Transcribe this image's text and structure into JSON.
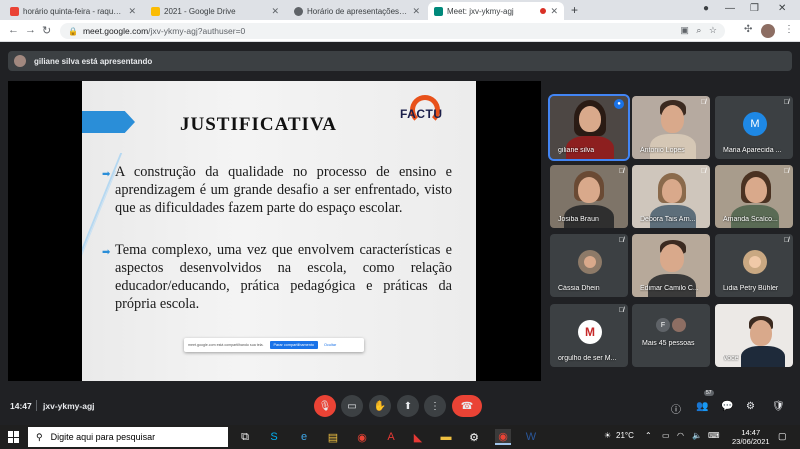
{
  "browser": {
    "tabs": [
      {
        "title": "horário quinta-feira - raquel.veto",
        "favicon": "gmail-icon",
        "color": "#ea4335"
      },
      {
        "title": "2021 - Google Drive",
        "favicon": "drive-icon",
        "color": "#fbbc04"
      },
      {
        "title": "Horário de apresentações de tra",
        "favicon": "globe-icon",
        "color": "#5f6368"
      },
      {
        "title": "Meet: jxv-ykmy-agj",
        "favicon": "meet-icon",
        "color": "#00897b"
      }
    ],
    "new_tab": "+",
    "url_host": "meet.google.com",
    "url_path": "/jxv-ykmy-agj?authuser=0"
  },
  "meet": {
    "presenter_text": "giliane silva está apresentando",
    "slide": {
      "title": "JUSTIFICATIVA",
      "logo_text": "FACTU",
      "paragraph_1": "A construção da qualidade no processo de ensino e aprendizagem é um grande desafio a ser enfrentado, visto que as dificuldades fazem parte do espaço escolar.",
      "paragraph_2": "Tema complexo, uma vez que envolvem características e aspectos desenvolvidos na escola, como relação educador/educando, prática pedagógica e práticas da própria escola.",
      "share_text": "meet.google.com está compartilhando sua tela.",
      "share_stop": "Parar compartilhamento",
      "share_hide": "Ocultar"
    },
    "participants": [
      {
        "name": "giliane silva",
        "kind": "photo"
      },
      {
        "name": "Antonio Lopes",
        "kind": "photo"
      },
      {
        "name": "Maria Aparecida ...",
        "kind": "avatar",
        "initial": "M",
        "avatar_color": "#1e88e5"
      },
      {
        "name": "Josiba Braun",
        "kind": "photo"
      },
      {
        "name": "Debora Tais Arn...",
        "kind": "photo"
      },
      {
        "name": "Amanda Scalco...",
        "kind": "photo"
      },
      {
        "name": "Cássia Dhein",
        "kind": "avatar-photo"
      },
      {
        "name": "Edimar Camilo C...",
        "kind": "photo"
      },
      {
        "name": "Lidia Petry Bühler",
        "kind": "avatar-photo"
      },
      {
        "name": "orgulho de ser M...",
        "kind": "avatar-logo"
      },
      {
        "name": "Mais 45 pessoas",
        "kind": "more",
        "initial": "F"
      },
      {
        "name": "Você",
        "kind": "photo"
      }
    ],
    "time": "14:47",
    "meeting_code": "jxv-ykmy-agj",
    "participant_count": "57"
  },
  "taskbar": {
    "search_placeholder": "Digite aqui para pesquisar",
    "weather": "21°C",
    "clock_time": "14:47",
    "clock_date": "23/06/2021"
  }
}
